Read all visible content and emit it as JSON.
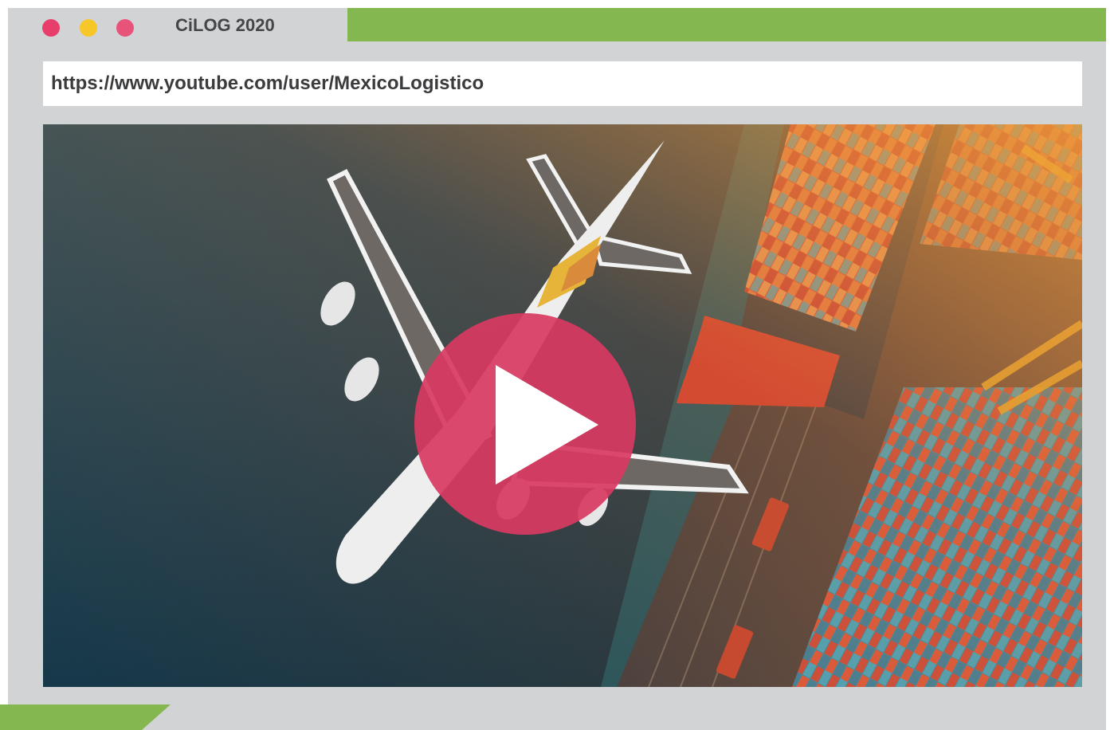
{
  "window": {
    "tab_title": "CiLOG 2020",
    "controls": [
      {
        "name": "close",
        "color": "#e83e6b"
      },
      {
        "name": "minimize",
        "color": "#f7c72a"
      },
      {
        "name": "maximize",
        "color": "#e8537a"
      }
    ],
    "frame_color": "#d2d3d5",
    "accent_color": "#85b750"
  },
  "address_bar": {
    "url": "https://www.youtube.com/user/MexicoLogistico"
  },
  "video": {
    "thumbnail_subject": "aerial view of airplane, container ship and port containers",
    "play_button_color": "#d93a62",
    "play_icon": "play-icon"
  }
}
